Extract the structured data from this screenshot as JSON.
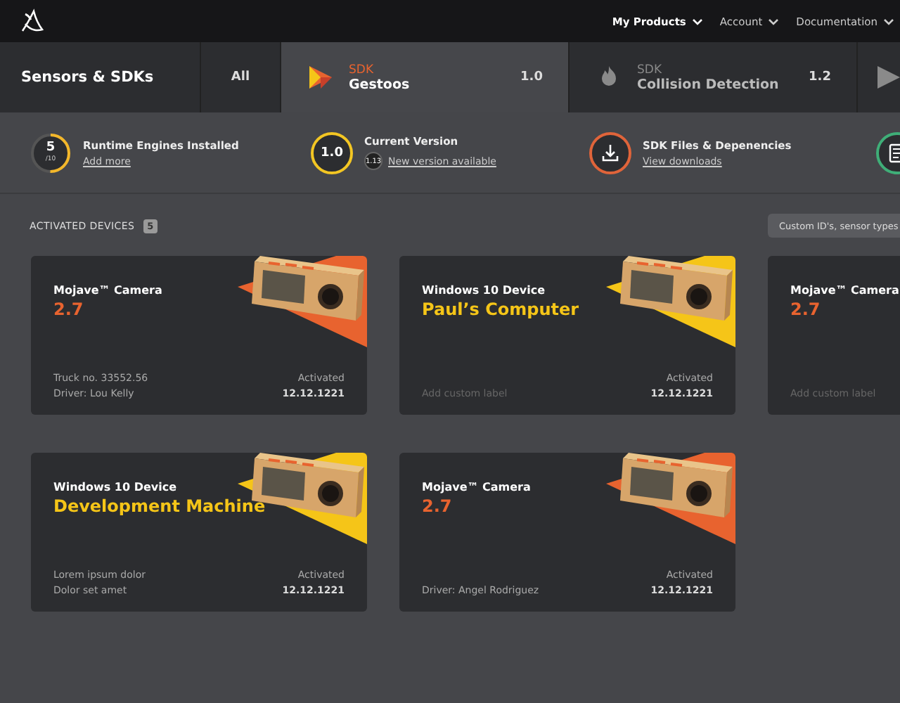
{
  "nav": [
    {
      "label": "My Products",
      "selected": true
    },
    {
      "label": "Account",
      "selected": false
    },
    {
      "label": "Documentation",
      "selected": false
    }
  ],
  "section_title": "Sensors & SDKs",
  "tabs": [
    {
      "kind": "text",
      "label": "All",
      "selected": false
    },
    {
      "kind": "sdk",
      "eyebrow": "SDK",
      "label": "Gestoos",
      "version": "1.0",
      "selected": true
    },
    {
      "kind": "sdk",
      "eyebrow": "SDK",
      "label": "Collision Detection",
      "version": "1.2",
      "selected": false
    },
    {
      "kind": "partial",
      "selected": false
    }
  ],
  "stats": [
    {
      "kind": "ring",
      "value": "5",
      "sub": "/10",
      "level": 0.5,
      "title": "Runtime Engines Installed",
      "link": "Add more"
    },
    {
      "kind": "version",
      "value": "1.0",
      "color": "#f3c623",
      "title": "Current Version",
      "badge": "1.13",
      "link": "New version available"
    },
    {
      "kind": "download",
      "color": "#e0643a",
      "title": "SDK Files & Depenencies",
      "link": "View downloads"
    },
    {
      "kind": "doc",
      "color": "#3fae78"
    }
  ],
  "devices": {
    "title": "ACTIVATED DEVICES",
    "count": "5",
    "search": {
      "placeholder": "Custom ID's, sensor types"
    }
  },
  "cards": [
    {
      "color": "#e8632f",
      "title": "Mojave™ Camera",
      "subtitle": "2.7",
      "lines": [
        "Truck no. 33552.56",
        "Driver: Lou Kelly"
      ],
      "status": "Activated",
      "date": "12.12.1221"
    },
    {
      "color": "#f5c518",
      "title": "Windows 10 Device",
      "subtitle": "Paul’s Computer",
      "placeholder": "Add custom label",
      "status": "Activated",
      "date": "12.12.1221"
    },
    {
      "color": "#e8632f",
      "title": "Mojave™ Camera",
      "subtitle": "2.7",
      "placeholder": "Add custom label"
    },
    {
      "color": "#f5c518",
      "title": "Windows 10 Device",
      "subtitle": "Development Machine",
      "lines": [
        "Lorem ipsum dolor",
        "Dolor set amet"
      ],
      "status": "Activated",
      "date": "12.12.1221"
    },
    {
      "color": "#e8632f",
      "title": "Mojave™ Camera",
      "subtitle": "2.7",
      "lines": [
        "Driver: Angel Rodriguez"
      ],
      "status": "Activated",
      "date": "12.12.1221"
    }
  ]
}
